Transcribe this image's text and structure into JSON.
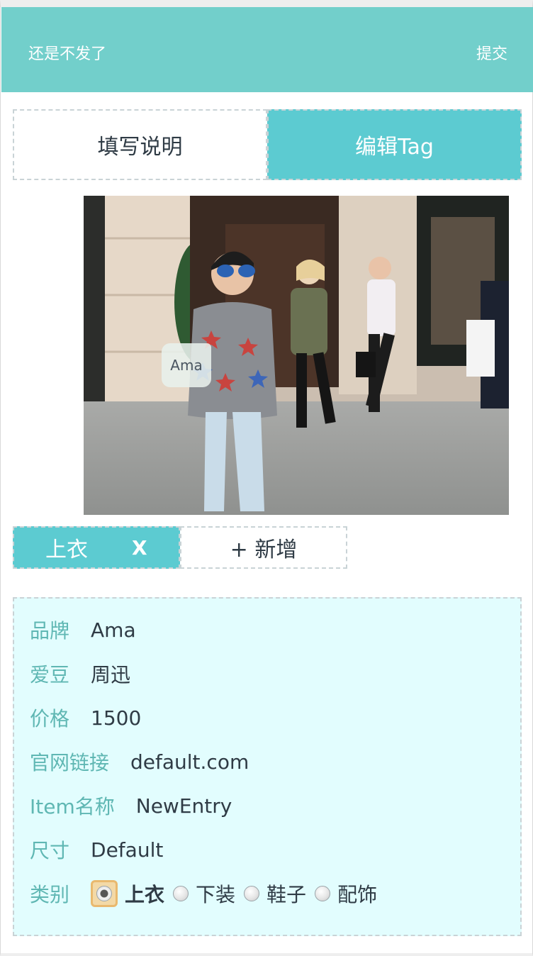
{
  "header": {
    "back_label": "还是不发了",
    "submit_label": "提交",
    "bg_color": "#72cfcb"
  },
  "tabs": [
    {
      "label": "填写说明",
      "active": false
    },
    {
      "label": "编辑Tag",
      "active": true
    }
  ],
  "photo": {
    "tag_bubble_label": "Ama"
  },
  "tag_bar": {
    "selected_tag": "上衣",
    "remove_label": "X",
    "add_label": "+ 新增"
  },
  "details": {
    "brand": {
      "label": "品牌",
      "value": "Ama"
    },
    "idol": {
      "label": "爱豆",
      "value": "周迅"
    },
    "price": {
      "label": "价格",
      "value": "1500"
    },
    "link": {
      "label": "官网链接",
      "value": "default.com"
    },
    "item_name": {
      "label": "Item名称",
      "value": "NewEntry"
    },
    "size": {
      "label": "尺寸",
      "value": "Default"
    },
    "category": {
      "label": "类别",
      "options": [
        "上衣",
        "下装",
        "鞋子",
        "配饰"
      ],
      "selected": "上衣"
    }
  },
  "colors": {
    "accent": "#5ccbd1",
    "label": "#5fb7b3",
    "details_bg": "#e2fdfe"
  }
}
